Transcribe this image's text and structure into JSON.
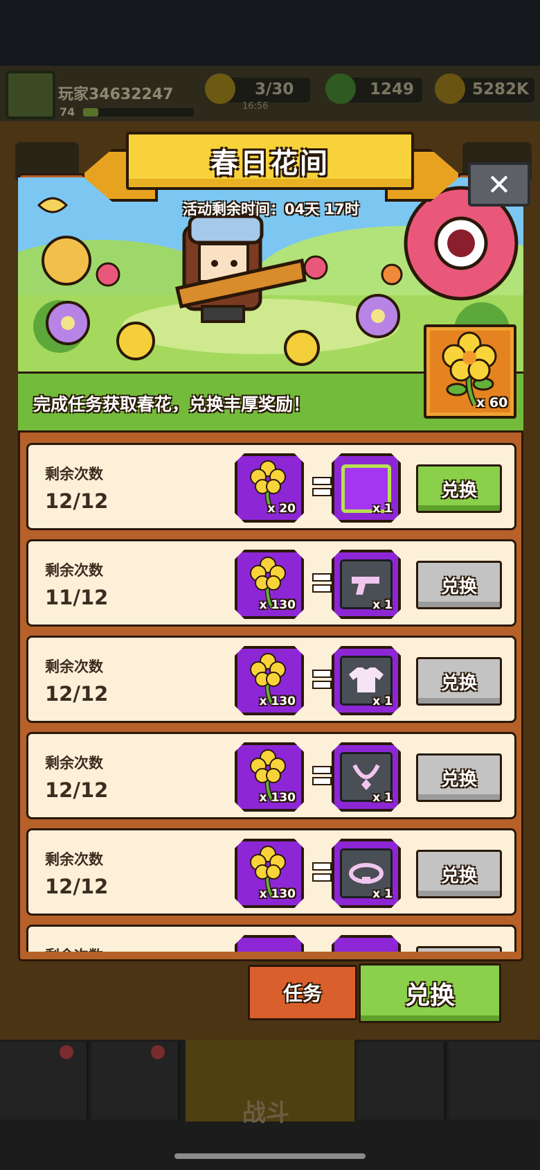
{
  "player": {
    "name": "玩家34632247",
    "level": "74",
    "xp_progress": 0.14
  },
  "resources": {
    "energy": {
      "value": "3/30",
      "timer": "16:56",
      "icon": "lightning-icon"
    },
    "gems": {
      "value": "1249",
      "icon": "gem-icon"
    },
    "coins": {
      "value": "5282K",
      "icon": "coin-icon"
    }
  },
  "dialog": {
    "title": "春日花间",
    "close_icon": "✕",
    "timer": "活动剩余时间：04天 17时",
    "task_hint": "完成任务获取春花，兑换丰厚奖励！",
    "currency_count": "x 60"
  },
  "exchange_rows": [
    {
      "label": "剩余次数",
      "count": "12/12",
      "cost": "x 20",
      "reward_qty": "x 1",
      "reward_icon": "avatar-frame-icon",
      "button": "兑换",
      "enabled": true
    },
    {
      "label": "剩余次数",
      "count": "11/12",
      "cost": "x 130",
      "reward_qty": "x 1",
      "reward_icon": "gun-icon",
      "button": "兑换",
      "enabled": false
    },
    {
      "label": "剩余次数",
      "count": "12/12",
      "cost": "x 130",
      "reward_qty": "x 1",
      "reward_icon": "shirt-icon",
      "button": "兑换",
      "enabled": false
    },
    {
      "label": "剩余次数",
      "count": "12/12",
      "cost": "x 130",
      "reward_qty": "x 1",
      "reward_icon": "necklace-icon",
      "button": "兑换",
      "enabled": false
    },
    {
      "label": "剩余次数",
      "count": "12/12",
      "cost": "x 130",
      "reward_qty": "x 1",
      "reward_icon": "belt-icon",
      "button": "兑换",
      "enabled": false
    },
    {
      "label": "剩余次数",
      "count": "",
      "cost": "",
      "reward_qty": "",
      "reward_icon": "box-icon",
      "button": "",
      "enabled": false
    }
  ],
  "tabs": {
    "task": "任务",
    "exchange": "兑换"
  },
  "bottom_nav": {
    "battle": "战斗"
  },
  "colors": {
    "accent_green": "#8ad04a",
    "tile_purple": "#8d27d6",
    "panel_orange": "#b6602a",
    "title_yellow": "#f7d23a"
  }
}
